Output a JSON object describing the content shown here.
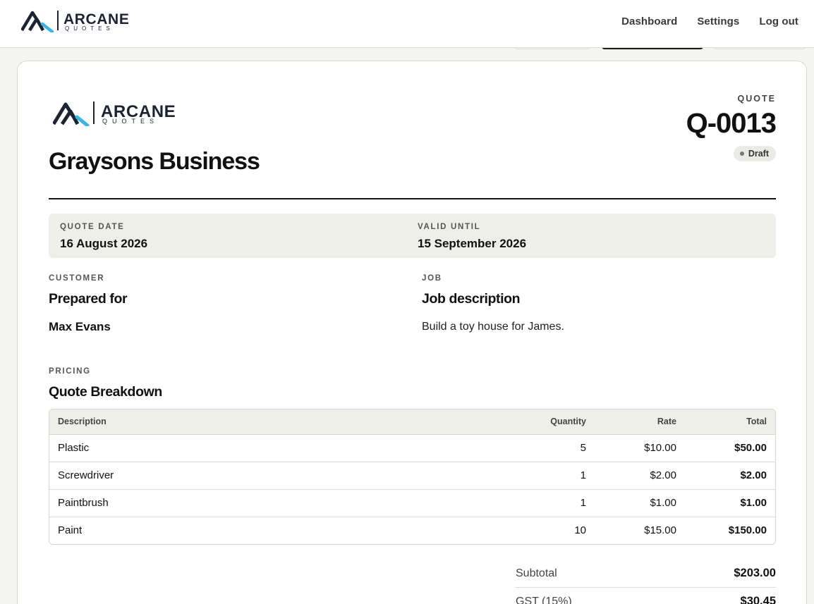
{
  "app": {
    "brand_name": "ARCANE",
    "brand_sub": "QUOTES"
  },
  "nav": {
    "items": [
      {
        "label": "Dashboard"
      },
      {
        "label": "Settings"
      },
      {
        "label": "Log out"
      }
    ]
  },
  "quote": {
    "business_name": "Graysons Business",
    "label": "QUOTE",
    "number": "Q-0013",
    "status": "Draft",
    "quote_date_label": "QUOTE DATE",
    "quote_date": "16 August 2026",
    "valid_until_label": "VALID UNTIL",
    "valid_until": "15 September 2026"
  },
  "customer": {
    "eyebrow": "CUSTOMER",
    "title": "Prepared for",
    "name": "Max Evans"
  },
  "job": {
    "eyebrow": "JOB",
    "title": "Job description",
    "description": "Build a toy house for James."
  },
  "pricing": {
    "eyebrow": "PRICING",
    "title": "Quote Breakdown",
    "columns": [
      "Description",
      "Quantity",
      "Rate",
      "Total"
    ],
    "rows": [
      {
        "description": "Plastic",
        "quantity": "5",
        "rate": "$10.00",
        "total": "$50.00"
      },
      {
        "description": "Screwdriver",
        "quantity": "1",
        "rate": "$2.00",
        "total": "$2.00"
      },
      {
        "description": "Paintbrush",
        "quantity": "1",
        "rate": "$1.00",
        "total": "$1.00"
      },
      {
        "description": "Paint",
        "quantity": "10",
        "rate": "$15.00",
        "total": "$150.00"
      }
    ]
  },
  "totals": {
    "subtotal_label": "Subtotal",
    "subtotal": "$203.00",
    "gst_label": "GST (15%)",
    "gst": "$30.45"
  },
  "colors": {
    "logo_dark": "#1c2433",
    "logo_accent": "#38b6e8",
    "background": "#f4f4f0"
  }
}
